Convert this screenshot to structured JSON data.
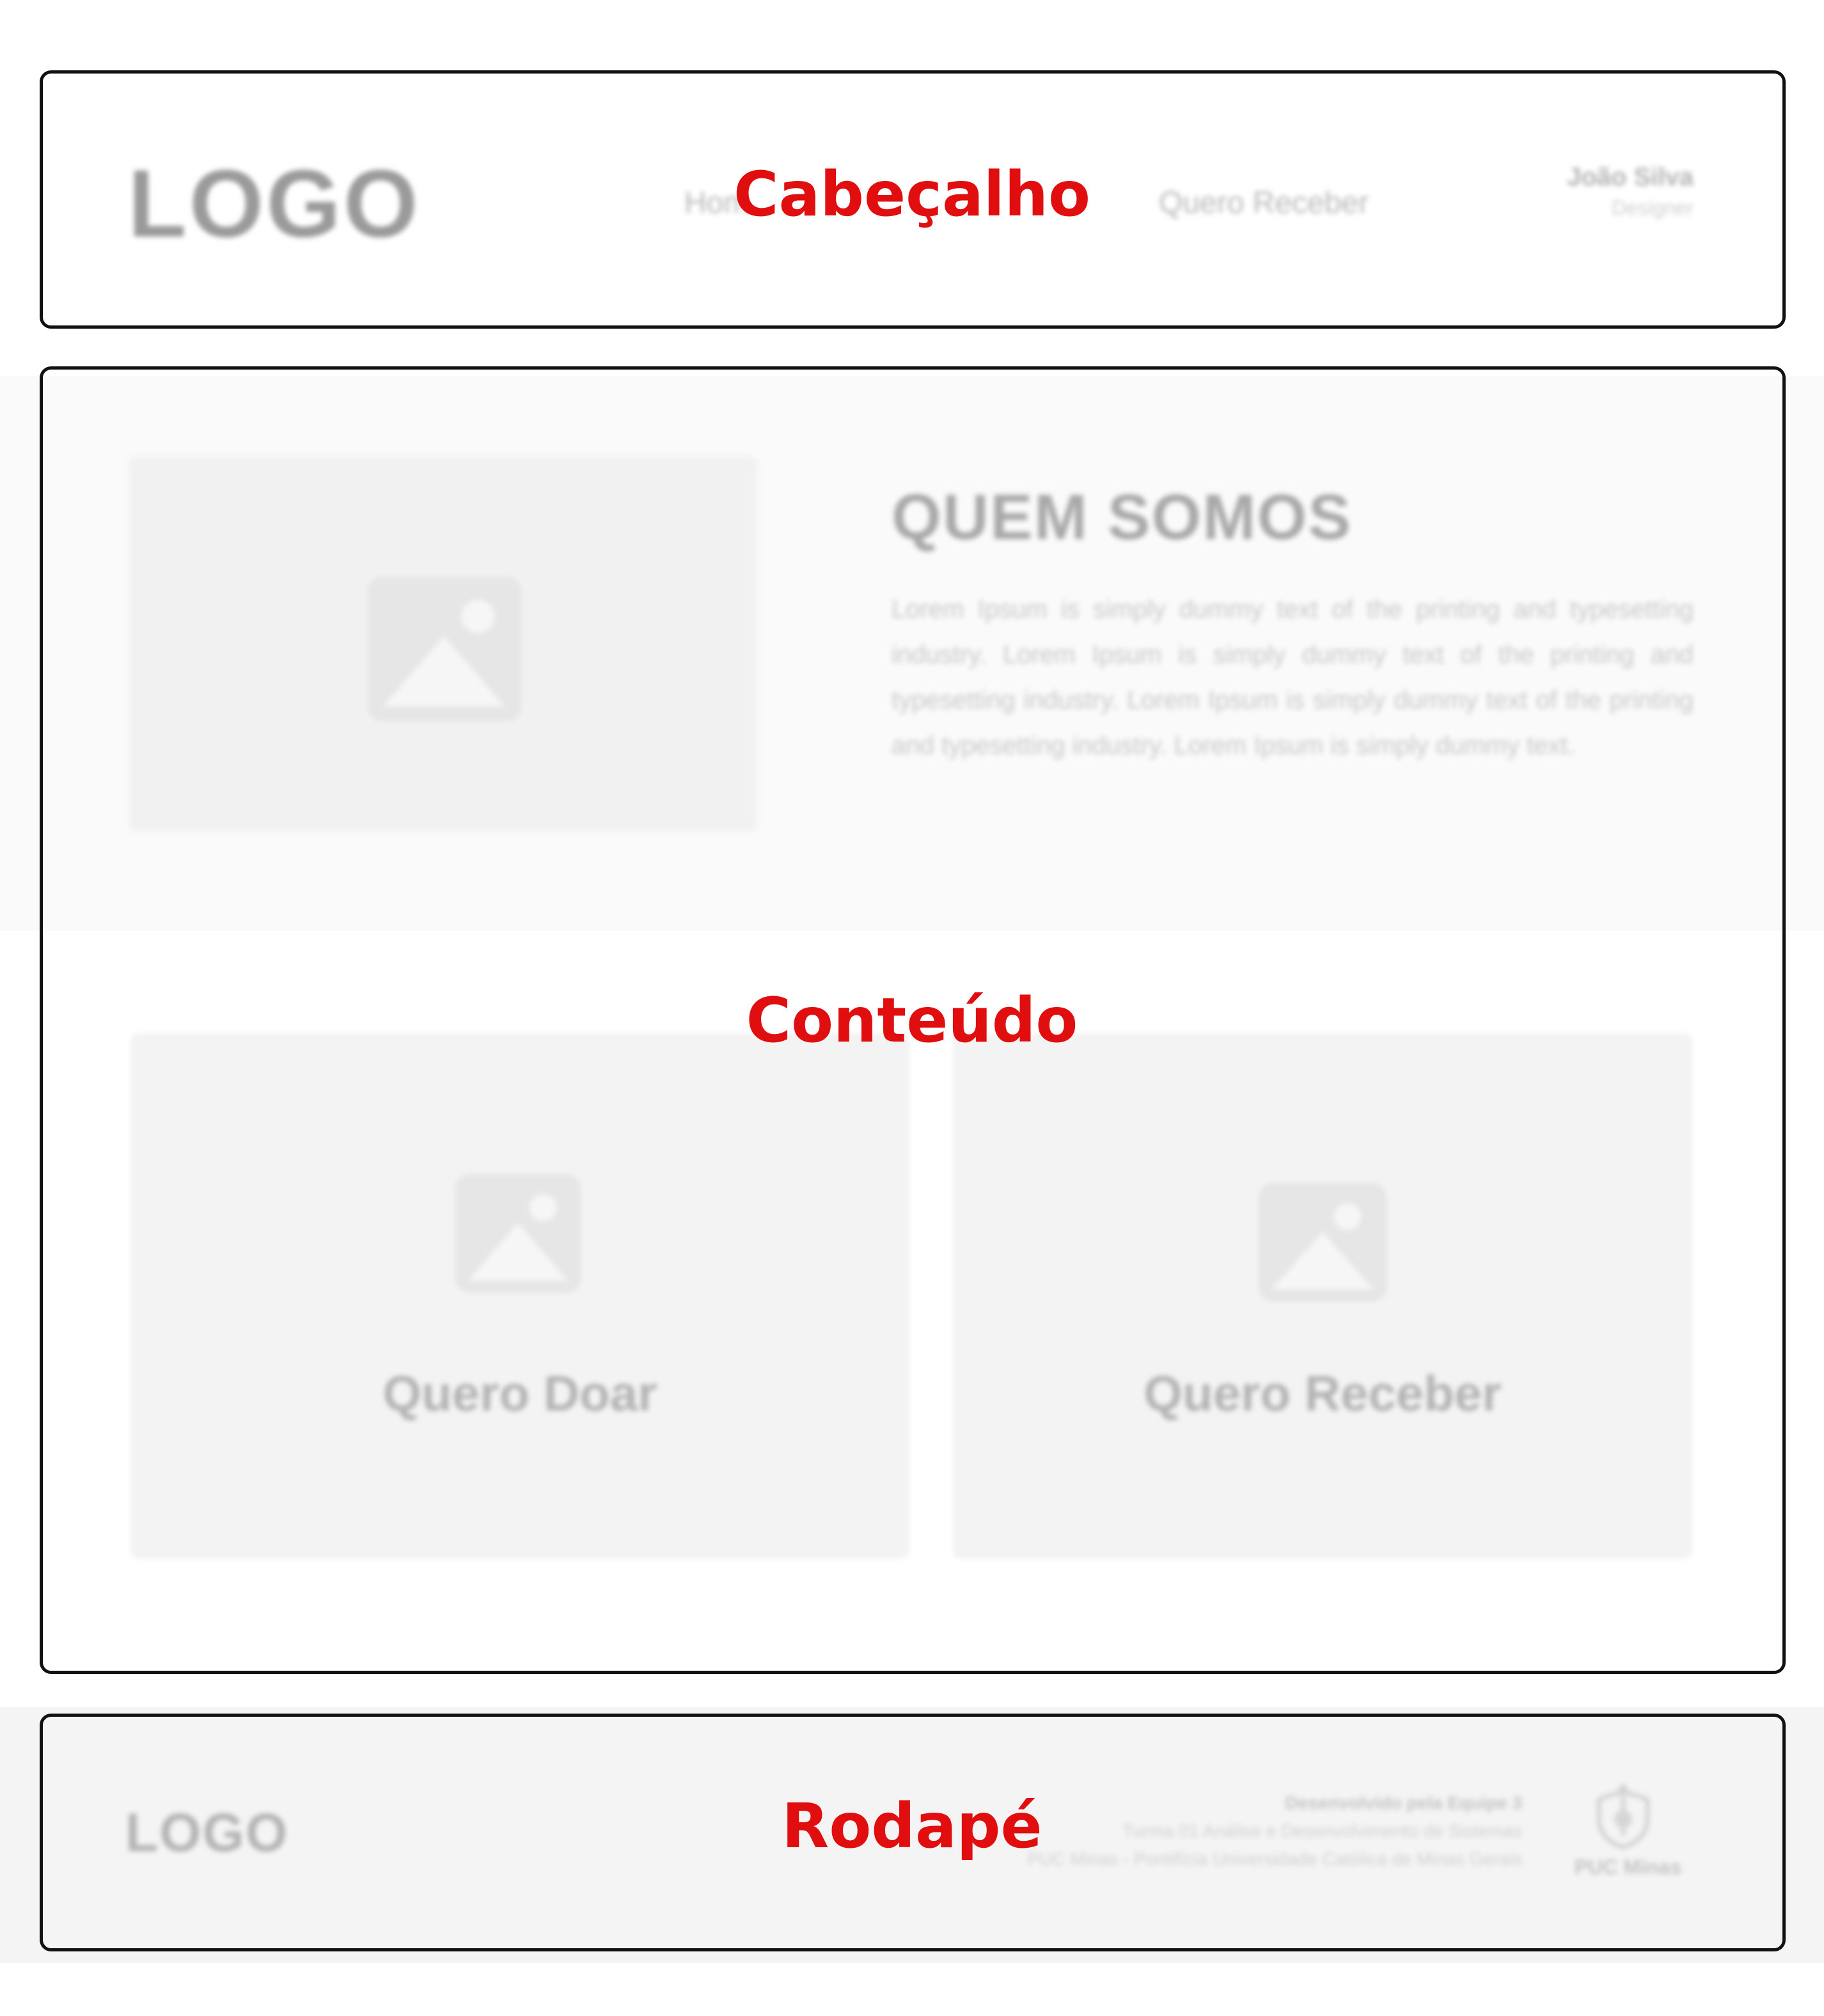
{
  "section_labels": {
    "header": "Cabeçalho",
    "content": "Conteúdo",
    "footer": "Rodapé"
  },
  "header": {
    "logo": "LOGO",
    "nav": [
      "Hom",
      "Quero Receber"
    ],
    "user": {
      "name": "João Silva",
      "role": "Designer"
    }
  },
  "about": {
    "image_icon": "image-placeholder-icon",
    "title": "QUEM SOMOS",
    "text": "Lorem Ipsum is simply dummy text of the printing and typesetting industry. Lorem Ipsum is simply dummy text of the printing and typesetting industry. Lorem Ipsum is simply dummy text of the printing and typesetting industry. Lorem Ipsum is simply dummy text."
  },
  "cards": [
    {
      "label": "Quero Doar",
      "icon": "image-placeholder-icon"
    },
    {
      "label": "Quero Receber",
      "icon": "image-placeholder-icon"
    }
  ],
  "footer": {
    "logo": "LOGO",
    "credits": [
      "Desenvolvido pela Equipe 3",
      "Turma 01 Análise e Desenvolvimento de Sistemas",
      "PUC Minas - Pontifícia Universidade Católica de Minas Gerais"
    ],
    "institution": "PUC Minas"
  },
  "colors": {
    "label_red": "#e00e0e",
    "outline": "#111111",
    "placeholder": "#f3f3f3"
  }
}
